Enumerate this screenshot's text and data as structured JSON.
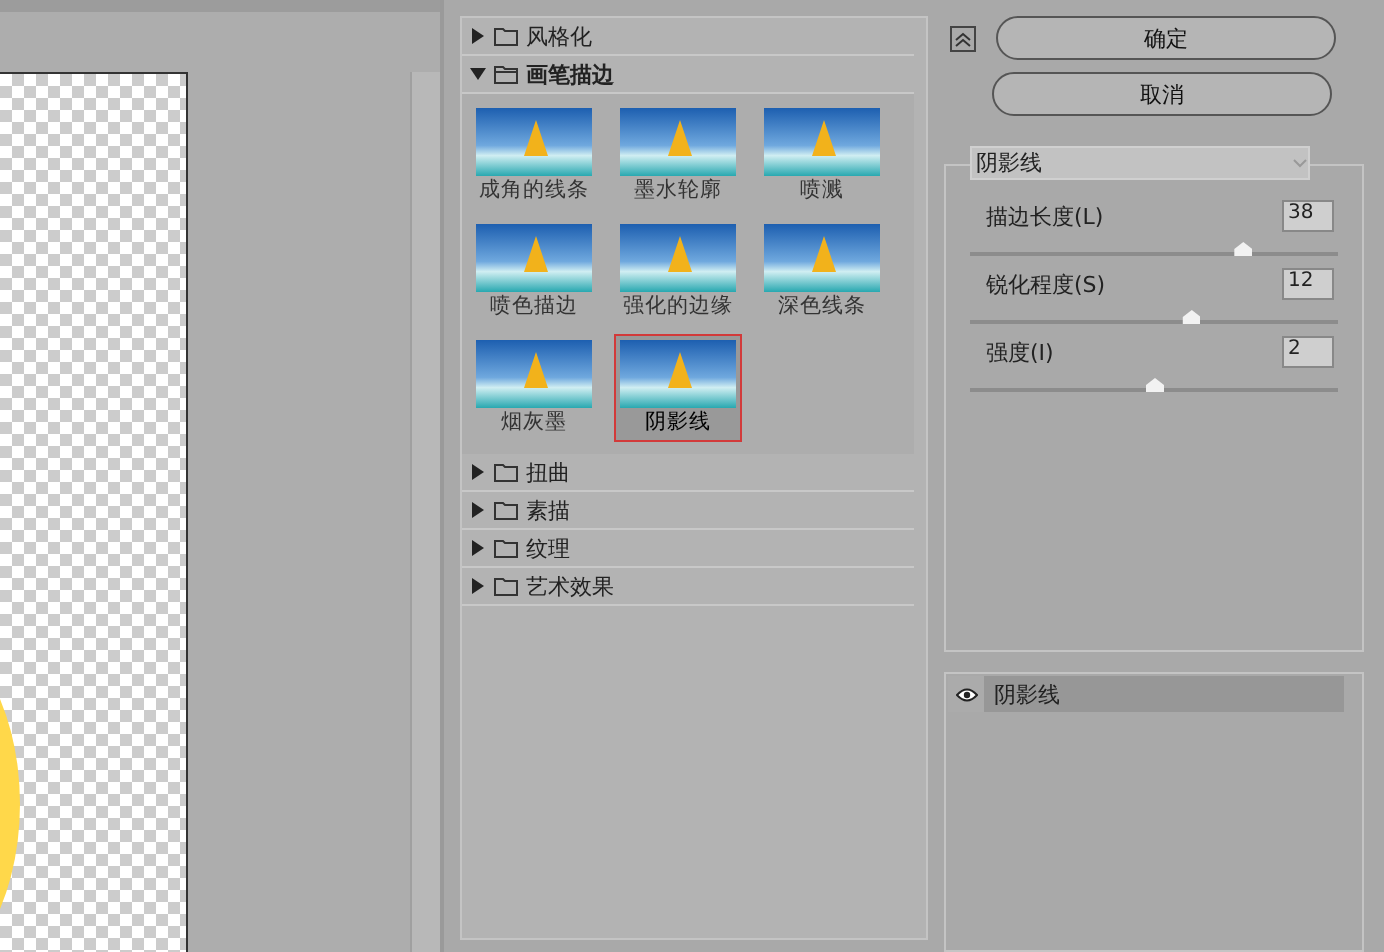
{
  "categories": [
    {
      "label": "风格化",
      "expanded": false
    },
    {
      "label": "画笔描边",
      "expanded": true,
      "filters": [
        {
          "label": "成角的线条",
          "selected": false
        },
        {
          "label": "墨水轮廓",
          "selected": false
        },
        {
          "label": "喷溅",
          "selected": false
        },
        {
          "label": "喷色描边",
          "selected": false
        },
        {
          "label": "强化的边缘",
          "selected": false
        },
        {
          "label": "深色线条",
          "selected": false
        },
        {
          "label": "烟灰墨",
          "selected": false
        },
        {
          "label": "阴影线",
          "selected": true
        }
      ]
    },
    {
      "label": "扭曲",
      "expanded": false
    },
    {
      "label": "素描",
      "expanded": false
    },
    {
      "label": "纹理",
      "expanded": false
    },
    {
      "label": "艺术效果",
      "expanded": false
    }
  ],
  "buttons": [
    "确定",
    "取消"
  ],
  "filter_select": {
    "value": "阴影线"
  },
  "params": [
    {
      "label": "描边长度(L)",
      "value": "38",
      "level": 0.74
    },
    {
      "label": "锐化程度(S)",
      "value": "12",
      "level": 0.6
    },
    {
      "label": "强度(I)",
      "value": "2",
      "level": 0.5
    }
  ],
  "effect_layers": [
    {
      "label": "阴影线",
      "visible": true
    }
  ]
}
